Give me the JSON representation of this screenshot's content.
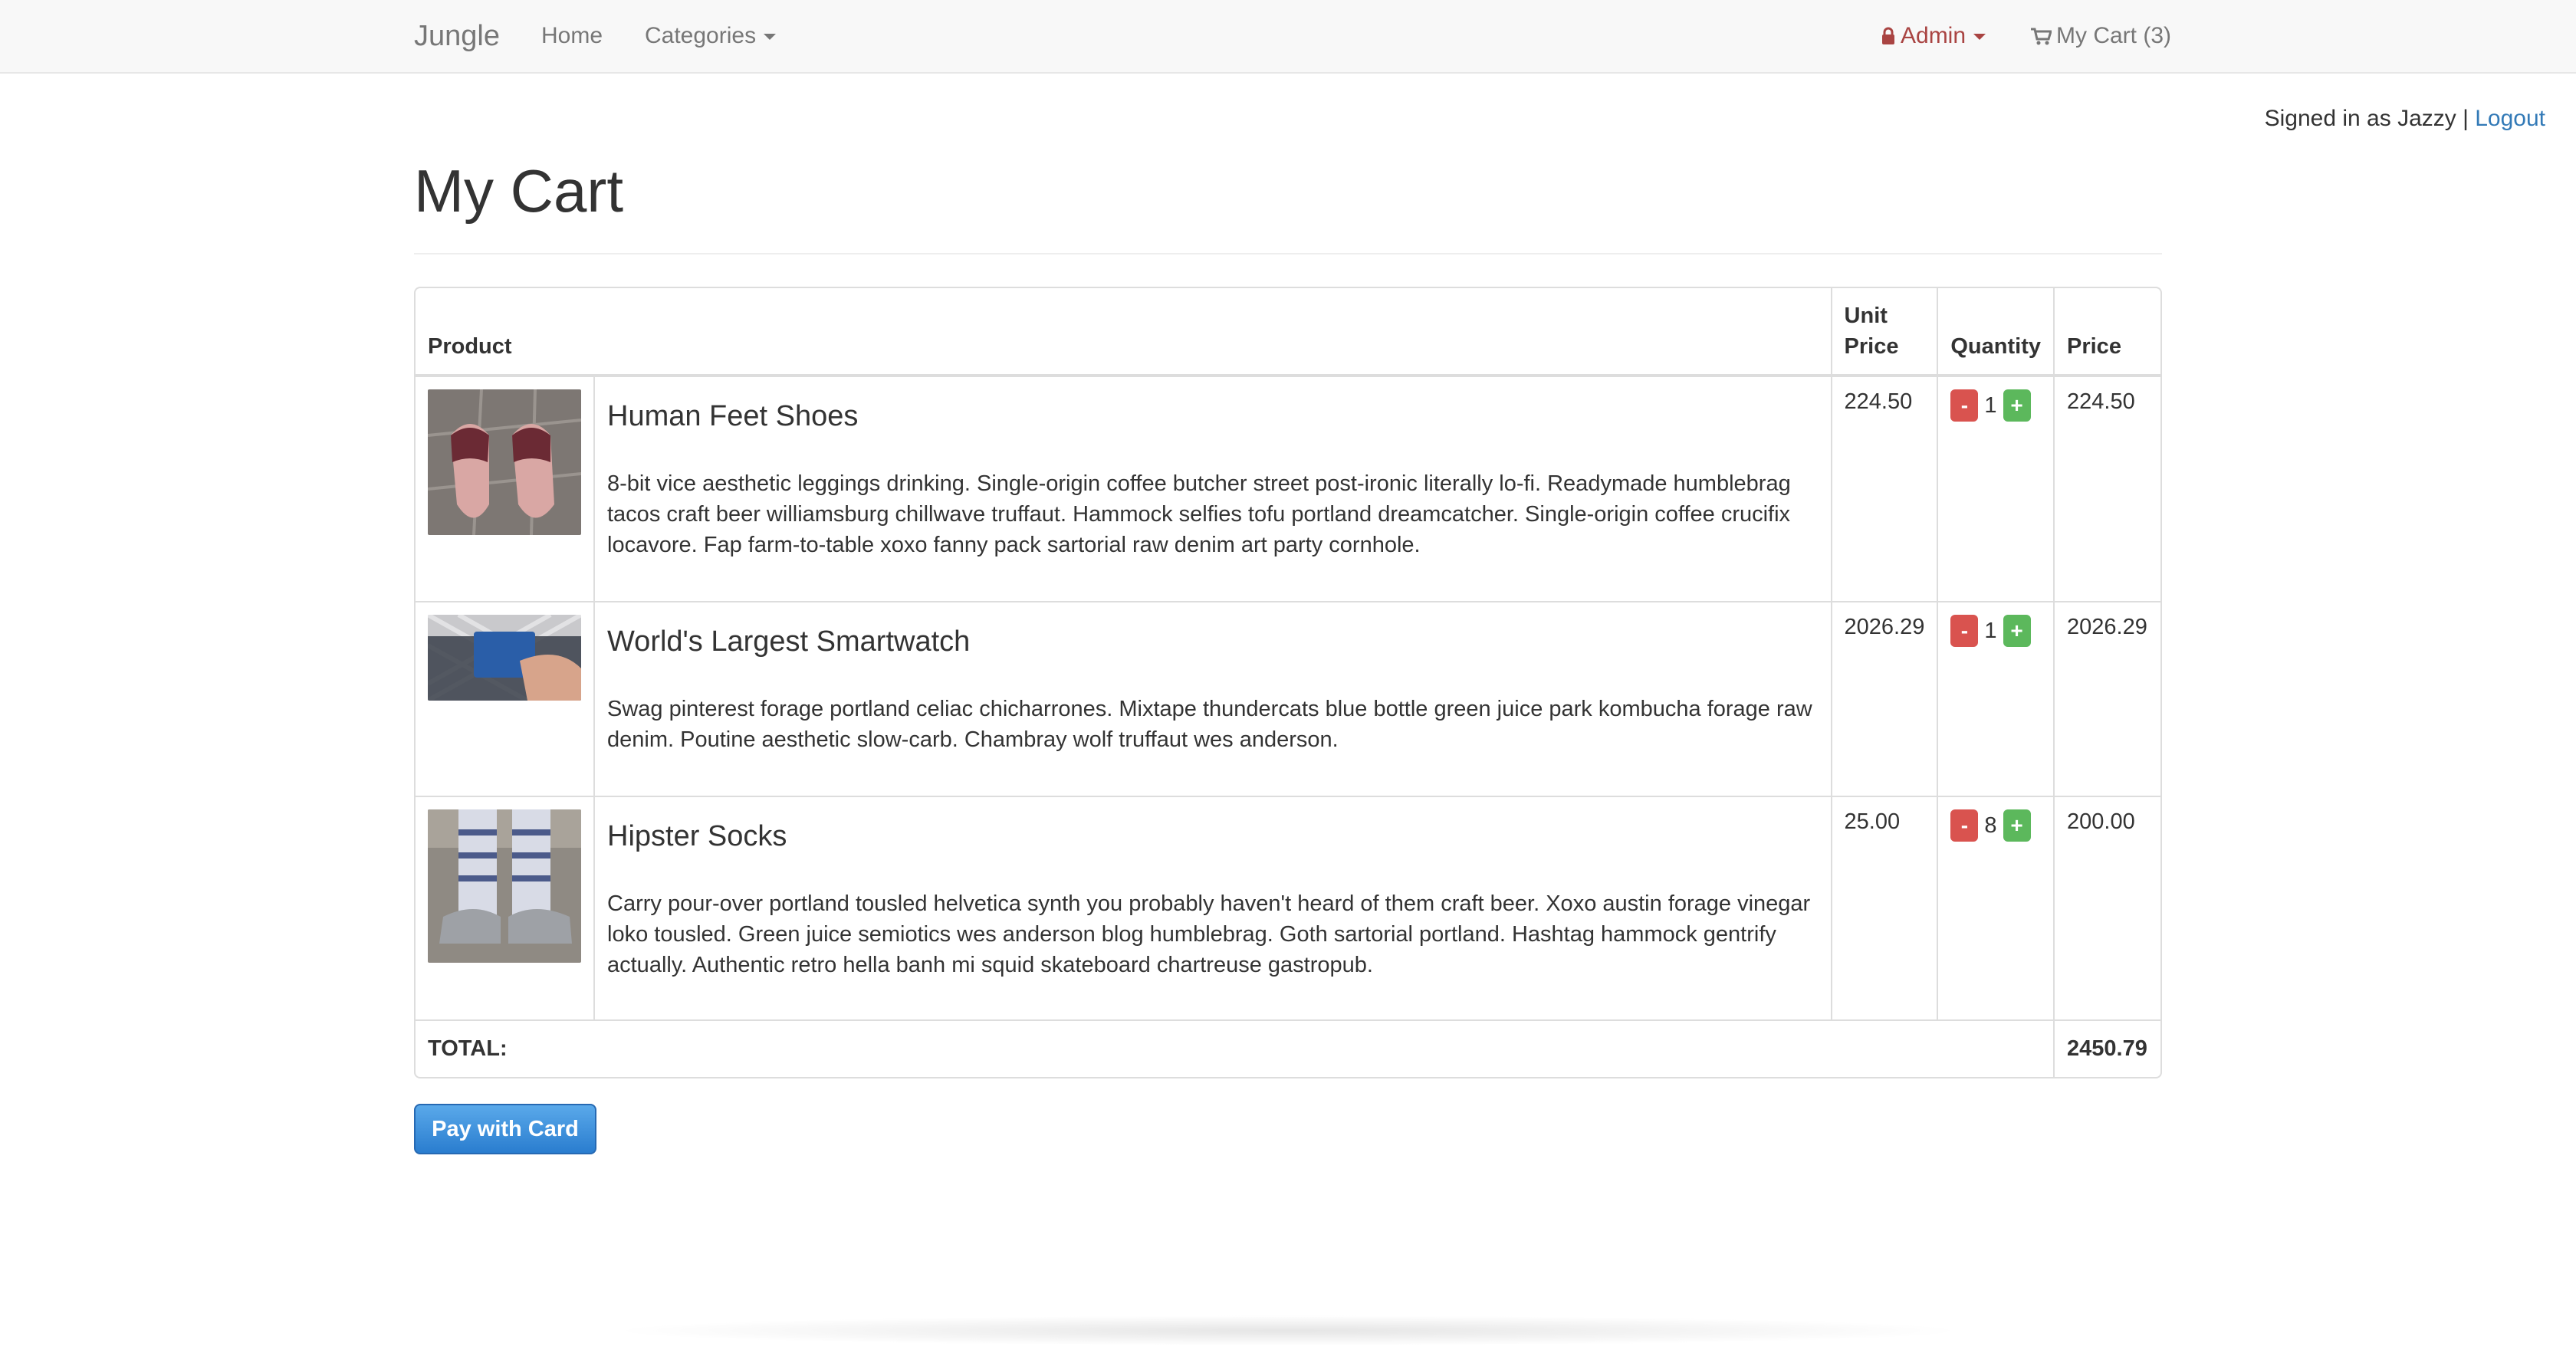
{
  "nav": {
    "brand": "Jungle",
    "home": "Home",
    "categories": "Categories",
    "admin": "Admin",
    "cart": "My Cart (3)"
  },
  "session": {
    "signed_in_text": "Signed in as Jazzy |",
    "logout": "Logout"
  },
  "page": {
    "title": "My Cart"
  },
  "table": {
    "headers": {
      "product": "Product",
      "unit_price": "Unit Price",
      "quantity": "Quantity",
      "price": "Price"
    },
    "items": [
      {
        "name": "Human Feet Shoes",
        "description": "8-bit vice aesthetic leggings drinking. Single-origin coffee butcher street post-ironic literally lo-fi. Readymade humblebrag tacos craft beer williamsburg chillwave truffaut. Hammock selfies tofu portland dreamcatcher. Single-origin coffee crucifix locavore. Fap farm-to-table xoxo fanny pack sartorial raw denim art party cornhole.",
        "unit_price": "224.50",
        "quantity": "1",
        "price": "224.50"
      },
      {
        "name": "World's Largest Smartwatch",
        "description": "Swag pinterest forage portland celiac chicharrones. Mixtape thundercats blue bottle green juice park kombucha forage raw denim. Poutine aesthetic slow-carb. Chambray wolf truffaut wes anderson.",
        "unit_price": "2026.29",
        "quantity": "1",
        "price": "2026.29"
      },
      {
        "name": "Hipster Socks",
        "description": "Carry pour-over portland tousled helvetica synth you probably haven't heard of them craft beer. Xoxo austin forage vinegar loko tousled. Green juice semiotics wes anderson blog humblebrag. Goth sartorial portland. Hashtag hammock gentrify actually. Authentic retro hella banh mi squid skateboard chartreuse gastropub.",
        "unit_price": "25.00",
        "quantity": "8",
        "price": "200.00"
      }
    ],
    "minus_label": "-",
    "plus_label": "+",
    "total_label": "TOTAL:",
    "total_value": "2450.79"
  },
  "actions": {
    "pay": "Pay with Card"
  },
  "colors": {
    "accent": "#337ab7",
    "danger": "#d9534f",
    "success": "#5cb85c",
    "admin": "#a94442"
  }
}
